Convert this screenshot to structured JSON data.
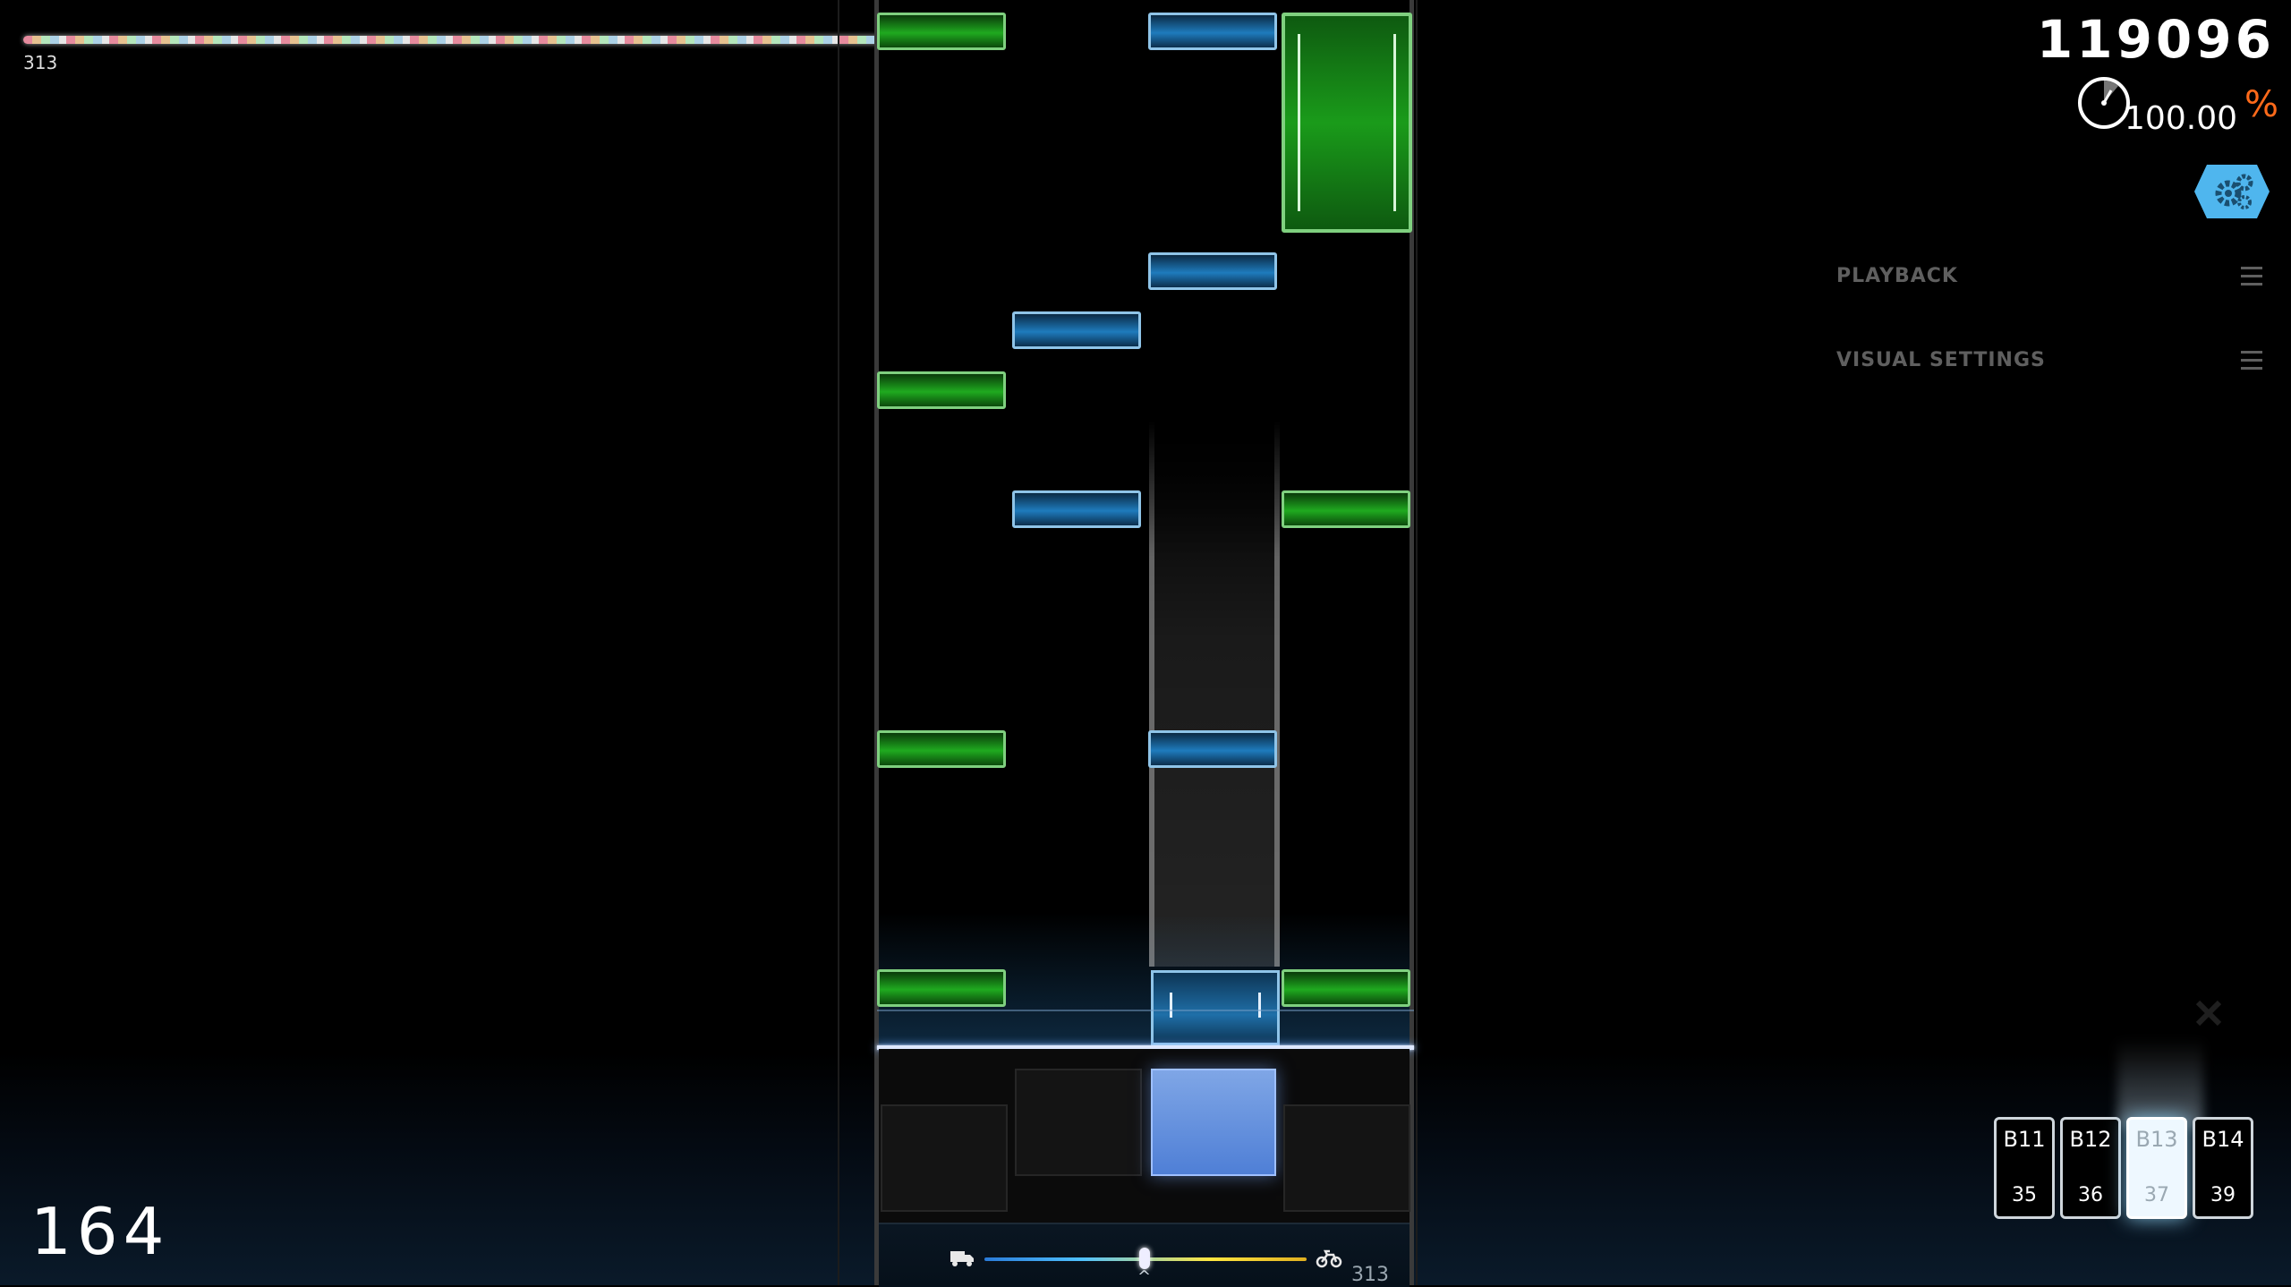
{
  "hud": {
    "score": "119096",
    "accuracy": "100.00",
    "percent_sign": "%",
    "combo": "164",
    "progress_label": "313",
    "progress": 1.0,
    "icons": {
      "clock": "clock-icon",
      "settings": "gear-icon",
      "close": "close-icon"
    }
  },
  "menu": {
    "playback": "PLAYBACK",
    "visual_settings": "VISUAL SETTINGS"
  },
  "speed": {
    "label": "313",
    "slow_icon": "truck-icon",
    "fast_icon": "bike-icon"
  },
  "pages": [
    {
      "name": "B11",
      "number": "35",
      "active": false
    },
    {
      "name": "B12",
      "number": "36",
      "active": false
    },
    {
      "name": "B13",
      "number": "37",
      "active": true
    },
    {
      "name": "B14",
      "number": "39",
      "active": false
    }
  ],
  "colors": {
    "accent": "#ff6a1a",
    "note_green": "#1faa1f",
    "note_blue": "#1e7bbd",
    "pressed_key": "#6f9ae0"
  }
}
